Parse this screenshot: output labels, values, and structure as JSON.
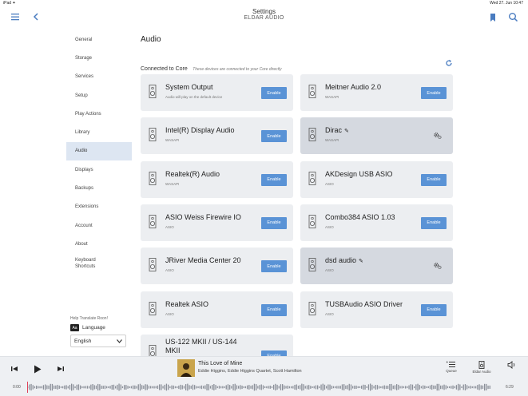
{
  "statusbar": {
    "left": "iPad  ✦",
    "right": "Wed 27. Jun  10:47"
  },
  "header": {
    "title": "Settings",
    "subtitle": "ELDAR AUDIO"
  },
  "sidebar": {
    "items": [
      {
        "label": "General"
      },
      {
        "label": "Storage"
      },
      {
        "label": "Services"
      },
      {
        "label": "Setup"
      },
      {
        "label": "Play Actions"
      },
      {
        "label": "Library"
      },
      {
        "label": "Audio"
      },
      {
        "label": "Displays"
      },
      {
        "label": "Backups"
      },
      {
        "label": "Extensions"
      },
      {
        "label": "Account"
      },
      {
        "label": "About"
      },
      {
        "label": "Keyboard Shortcuts"
      }
    ],
    "help": "Help Translate Roon!",
    "language_icon": "Aa",
    "language_label": "Language",
    "language_value": "English"
  },
  "main": {
    "title": "Audio",
    "section_label": "Connected to Core",
    "section_desc": "These devices are connected to your Core directly",
    "enable_label": "Enable",
    "devices": [
      {
        "name": "System Output",
        "sub": "Audio will play on the default device",
        "state": "enable"
      },
      {
        "name": "Meitner Audio 2.0",
        "sub": "WASAPI",
        "state": "enable"
      },
      {
        "name": "Intel(R) Display Audio",
        "sub": "WASAPI",
        "state": "enable"
      },
      {
        "name": "Dirac",
        "sub": "WASAPI",
        "state": "configured"
      },
      {
        "name": "Realtek(R) Audio",
        "sub": "WASAPI",
        "state": "enable"
      },
      {
        "name": "AKDesign USB ASIO",
        "sub": "ASIO",
        "state": "enable"
      },
      {
        "name": "ASIO Weiss Firewire IO",
        "sub": "ASIO",
        "state": "enable"
      },
      {
        "name": "Combo384 ASIO 1.03",
        "sub": "ASIO",
        "state": "enable"
      },
      {
        "name": "JRiver Media Center 20",
        "sub": "ASIO",
        "state": "enable"
      },
      {
        "name": "dsd audio",
        "sub": "ASIO",
        "state": "configured"
      },
      {
        "name": "Realtek ASIO",
        "sub": "ASIO",
        "state": "enable"
      },
      {
        "name": "TUSBAudio ASIO Driver",
        "sub": "ASIO",
        "state": "enable"
      },
      {
        "name": "US-122 MKII / US-144 MKII",
        "sub": "",
        "state": "enable"
      }
    ]
  },
  "player": {
    "track": "This Love of Mine",
    "artist": "Eddie Higgins, Eddie Higgins Quartet, Scott Hamilton",
    "queue_label": "Queue",
    "zone_label": "Eldar Audio",
    "elapsed": "0:00",
    "duration": "6:29"
  },
  "colors": {
    "accent": "#5a93d6",
    "active_bg": "#dde6f2",
    "card_bg": "#eceef1"
  }
}
